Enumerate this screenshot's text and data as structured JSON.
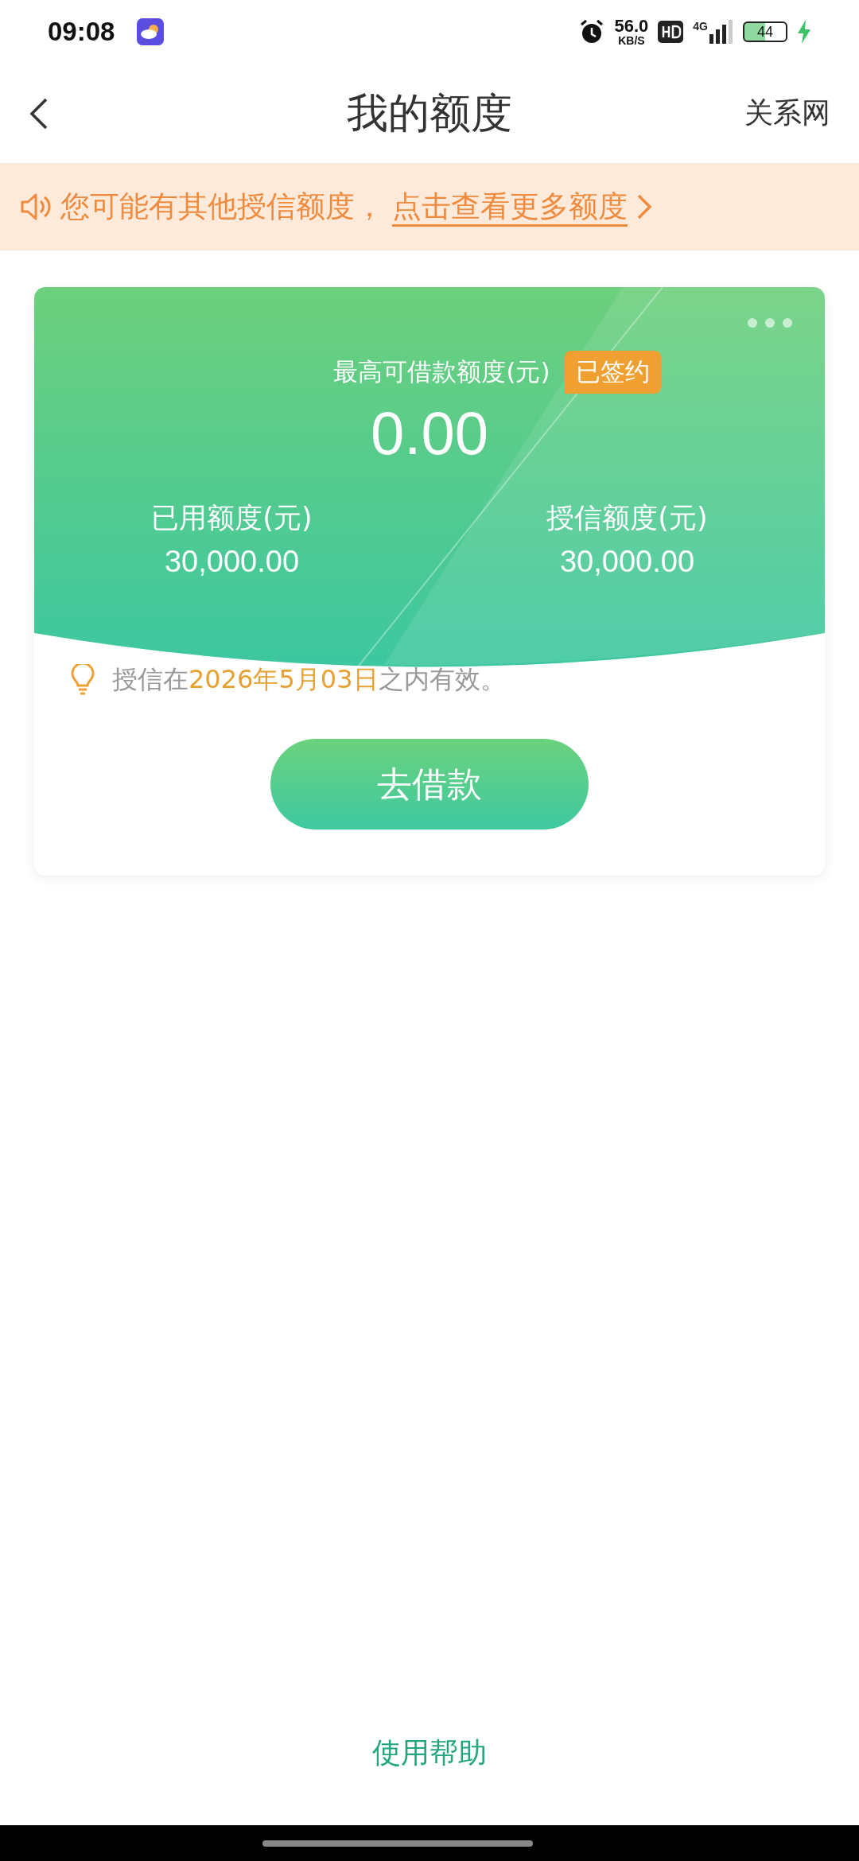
{
  "status_bar": {
    "time": "09:08",
    "speed": "56.0",
    "speed_unit": "KB/S",
    "network": "4G",
    "battery": "44"
  },
  "nav": {
    "title": "我的额度",
    "action": "关系网"
  },
  "notice": {
    "text": "您可能有其他授信额度，",
    "link": "点击查看更多额度"
  },
  "card": {
    "max_label": "最高可借款额度(元)",
    "badge": "已签约",
    "max_value": "0.00",
    "stats": [
      {
        "label": "已用额度(元)",
        "value": "30,000.00"
      },
      {
        "label": "授信额度(元)",
        "value": "30,000.00"
      }
    ],
    "validity": "授信在**2026年5月03日**之内有效。",
    "button": "去借款"
  },
  "help_link": "使用帮助"
}
